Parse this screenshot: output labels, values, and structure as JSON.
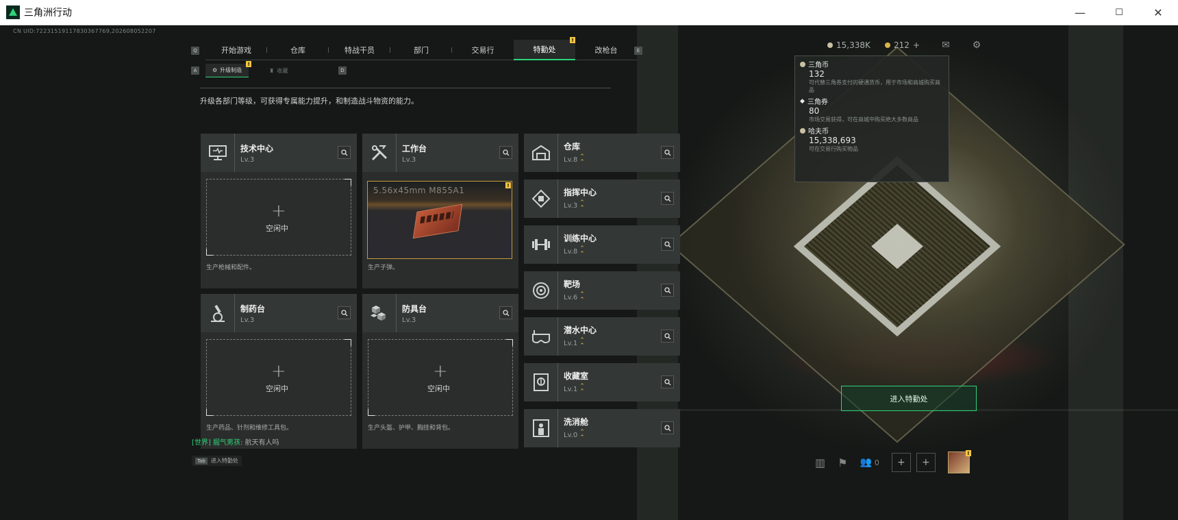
{
  "window": {
    "title": "三角洲行动",
    "minimize": "—",
    "maximize": "☐",
    "close": "✕"
  },
  "uid": "CN UID:72231519117830367769,202608052207",
  "topnav": {
    "left_key": "Q",
    "right_key": "E",
    "tabs": [
      "开始游戏",
      "仓库",
      "特战干员",
      "部门",
      "交易行",
      "特勤处",
      "改枪台"
    ],
    "active": "特勤处",
    "badge": "!"
  },
  "subtabs": {
    "left_key": "A",
    "right_key": "D",
    "items": [
      "升级制造",
      "收藏"
    ],
    "badge": "!"
  },
  "description": "升级各部门等级，可获得专属能力提升，和制造战斗物资的能力。",
  "currency": {
    "hafcoin": "15,338K",
    "coupon": "212",
    "add": "+"
  },
  "tooltip": {
    "items": [
      {
        "name": "三角币",
        "value": "132",
        "desc": "可代替三角券支付的硬通货币，用于市场和商城购买商品"
      },
      {
        "name": "三角券",
        "value": "80",
        "desc": "市场交易获得，可在商城中购买绝大多数商品"
      },
      {
        "name": "哈夫币",
        "value": "15,338,693",
        "desc": "可在交易行购买物品"
      }
    ]
  },
  "workbenches": [
    {
      "name": "技术中心",
      "level": "Lv.3",
      "idle": "空闲中",
      "footer": "生产枪械和配件。",
      "icon": "monitor-icon"
    },
    {
      "name": "工作台",
      "level": "Lv.3",
      "item": "5.56x45mm M855A1",
      "footer": "生产子弹。",
      "icon": "tools-icon",
      "badge": "!"
    },
    {
      "name": "制药台",
      "level": "Lv.3",
      "idle": "空闲中",
      "footer": "生产药品、针剂和维修工具包。",
      "icon": "microscope-icon"
    },
    {
      "name": "防具台",
      "level": "Lv.3",
      "idle": "空闲中",
      "footer": "生产头盔、护甲、胸挂和背包。",
      "icon": "cubes-icon"
    }
  ],
  "facilities": [
    {
      "name": "仓库",
      "level": "Lv.8",
      "icon": "warehouse-icon"
    },
    {
      "name": "指挥中心",
      "level": "Lv.3",
      "icon": "chip-icon"
    },
    {
      "name": "训练中心",
      "level": "Lv.8",
      "icon": "dumbbell-icon"
    },
    {
      "name": "靶场",
      "level": "Lv.6",
      "icon": "target-icon"
    },
    {
      "name": "潜水中心",
      "level": "Lv.1",
      "icon": "diving-mask-icon"
    },
    {
      "name": "收藏室",
      "level": "Lv.1",
      "icon": "vault-icon"
    },
    {
      "name": "洗消舱",
      "level": "Lv.0",
      "icon": "decon-icon"
    }
  ],
  "chat": {
    "channel": "[世界]",
    "player": "掘气男孩:",
    "message": "航天有人吗"
  },
  "tab_hint": {
    "key": "Tab",
    "label": "进入特勤处"
  },
  "enter_button": "进入特勤处",
  "bottom_bar": {
    "squad_count": "0"
  },
  "colors": {
    "accent": "#2fd37a",
    "badge": "#f5c542",
    "level_arrow": "#e8b93c"
  }
}
